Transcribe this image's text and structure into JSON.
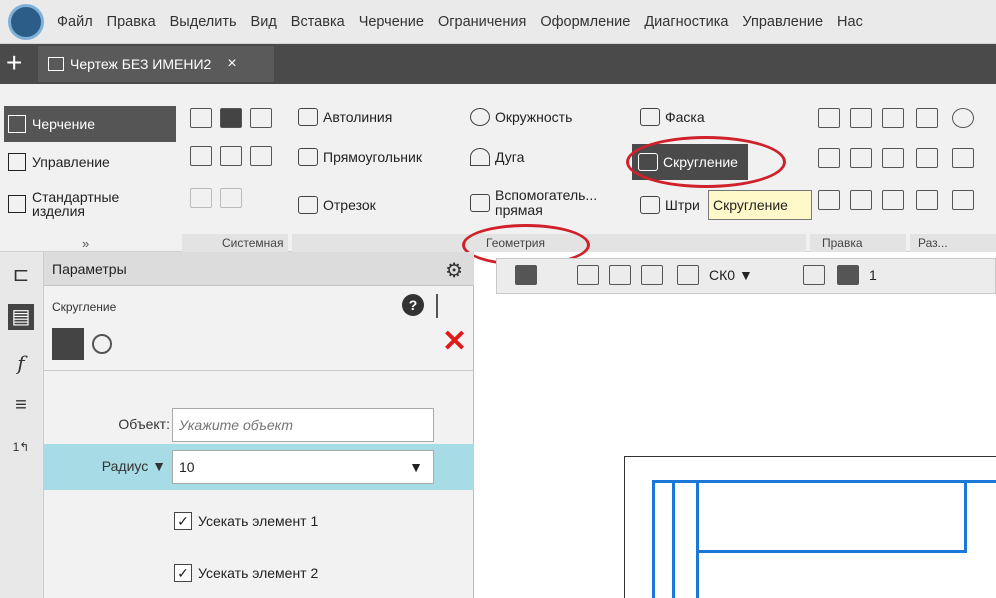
{
  "menu": [
    "Файл",
    "Правка",
    "Выделить",
    "Вид",
    "Вставка",
    "Черчение",
    "Ограничения",
    "Оформление",
    "Диагностика",
    "Управление",
    "Нас"
  ],
  "doc_tab": {
    "title": "Чертеж БЕЗ ИМЕНИ2",
    "close": "×",
    "add": "+"
  },
  "ribbon_nav": [
    {
      "label": "Черчение",
      "active": true
    },
    {
      "label": "Управление",
      "active": false
    },
    {
      "label": "Стандартные изделия",
      "active": false
    }
  ],
  "ribbon_collapse": "»",
  "groups": {
    "system": "Системная",
    "geometry": "Геометрия",
    "edit": "Правка",
    "size": "Раз..."
  },
  "geometry_buttons": {
    "autoline": "Автолиния",
    "rectangle": "Прямоугольник",
    "segment": "Отрезок",
    "circle": "Окружность",
    "arc": "Дуга",
    "auxiliary": "Вспомогатель... прямая",
    "chamfer": "Фаска",
    "fillet": "Скругление",
    "hatch": "Штри"
  },
  "tooltip": "Скругление",
  "params": {
    "header": "Параметры",
    "subtitle": "Скругление",
    "object_label": "Объект:",
    "object_placeholder": "Укажите объект",
    "radius_label": "Радиус",
    "radius_value": "10",
    "trim1": "Усекать элемент 1",
    "trim2": "Усекать элемент 2"
  },
  "toolbar2": {
    "cs": "СК0",
    "scale": "1"
  },
  "colors": {
    "accent": "#d0202a",
    "highlight": "#a7dce6",
    "drawing": "#1c78d8"
  }
}
